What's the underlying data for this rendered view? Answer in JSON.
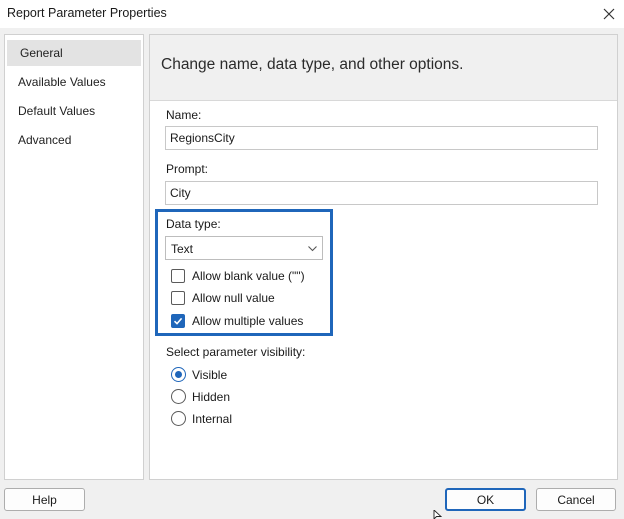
{
  "window": {
    "title": "Report Parameter Properties"
  },
  "sidebar": {
    "items": [
      {
        "label": "General",
        "selected": true
      },
      {
        "label": "Available Values",
        "selected": false
      },
      {
        "label": "Default Values",
        "selected": false
      },
      {
        "label": "Advanced",
        "selected": false
      }
    ]
  },
  "main": {
    "header": "Change name, data type, and other options.",
    "name_label": "Name:",
    "name_value": "RegionsCity",
    "prompt_label": "Prompt:",
    "prompt_value": "City",
    "datatype_label": "Data type:",
    "datatype_value": "Text",
    "checkboxes": [
      {
        "label": "Allow blank value (\"\")",
        "checked": false
      },
      {
        "label": "Allow null value",
        "checked": false
      },
      {
        "label": "Allow multiple values",
        "checked": true
      }
    ],
    "visibility_label": "Select parameter visibility:",
    "visibility_options": [
      {
        "label": "Visible",
        "selected": true
      },
      {
        "label": "Hidden",
        "selected": false
      },
      {
        "label": "Internal",
        "selected": false
      }
    ]
  },
  "footer": {
    "help": "Help",
    "ok": "OK",
    "cancel": "Cancel"
  },
  "colors": {
    "accent": "#1f66ba",
    "highlight_border": "#1f66ba"
  }
}
